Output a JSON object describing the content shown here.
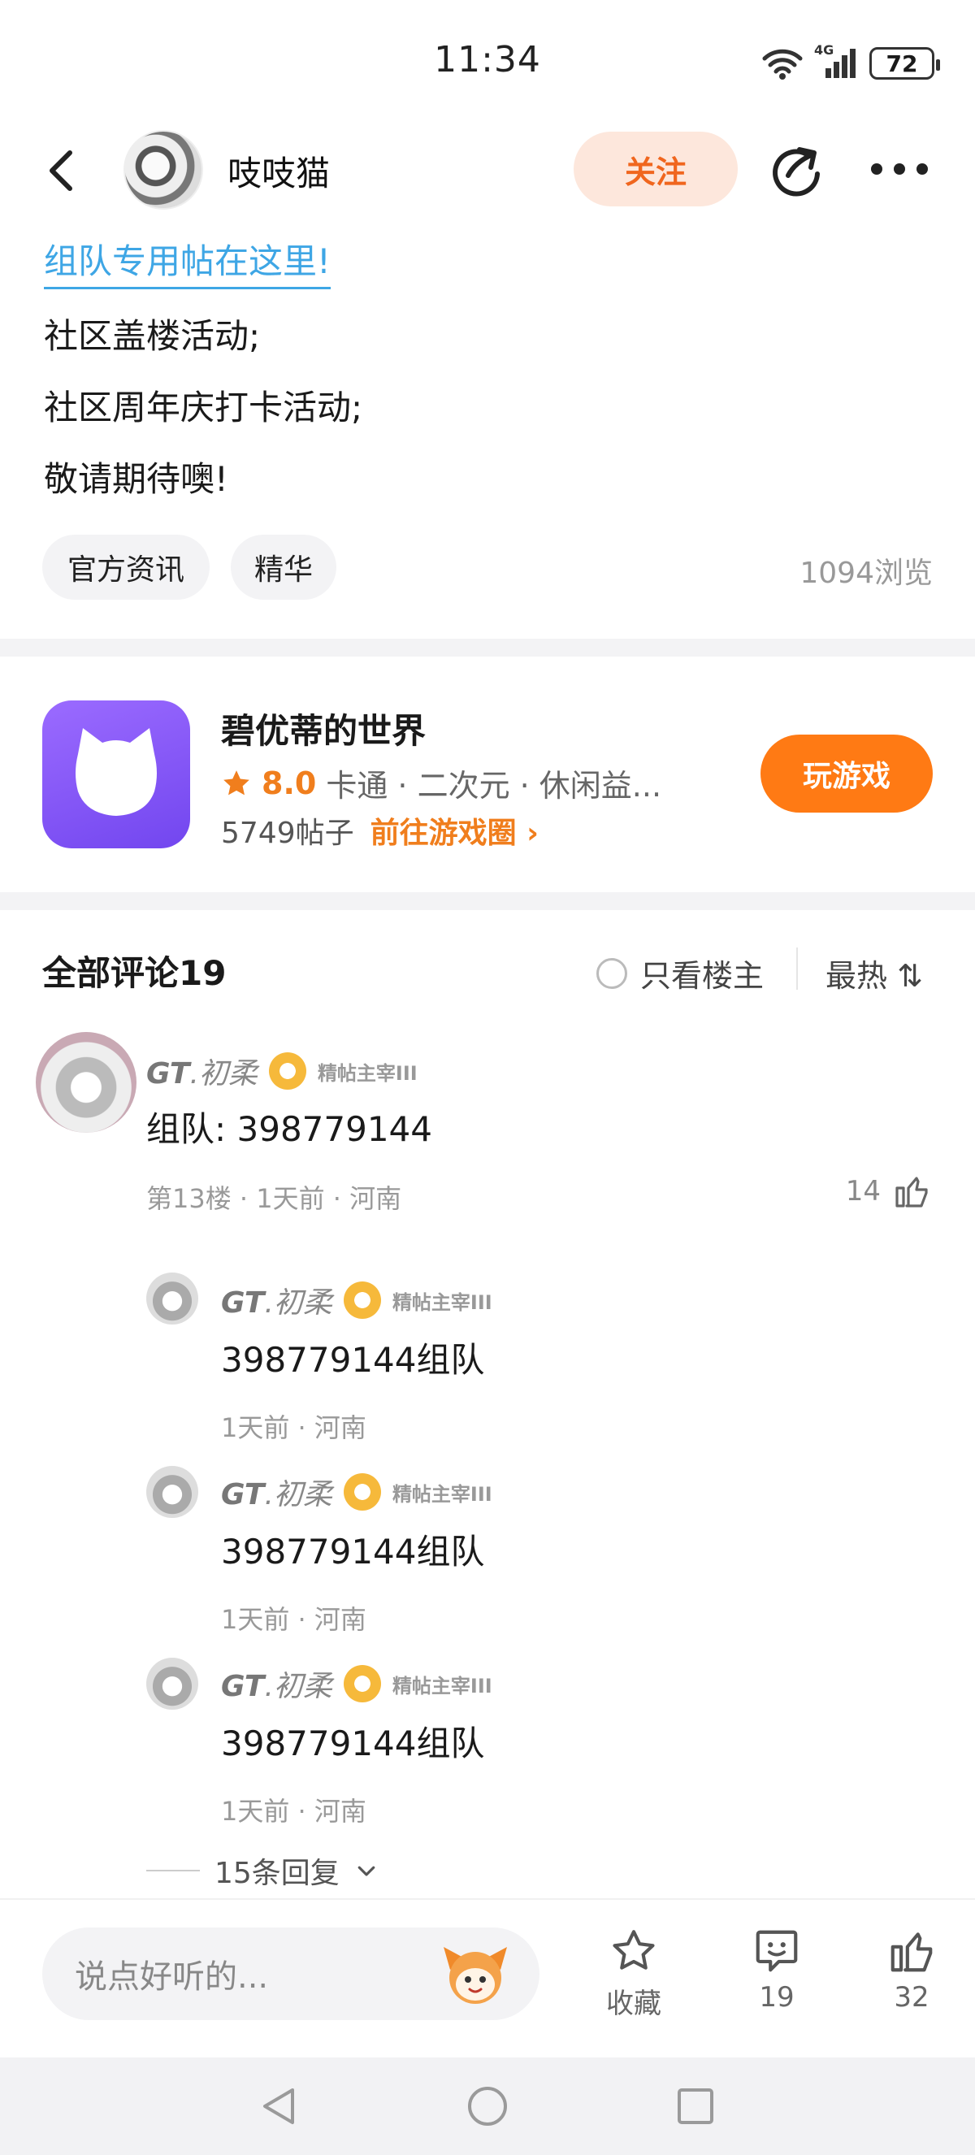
{
  "status_bar": {
    "time": "11:34",
    "battery": "72",
    "network": "4G"
  },
  "header": {
    "author": "吱吱猫",
    "follow_label": "关注"
  },
  "post": {
    "link_text": "组队专用帖在这里!",
    "lines": [
      "社区盖楼活动;",
      "社区周年庆打卡活动;",
      "敬请期待噢!"
    ],
    "tags": [
      "官方资讯",
      "精华"
    ],
    "views": "1094浏览"
  },
  "game": {
    "title": "碧优蒂的世界",
    "rating": "8.0",
    "tags": "卡通 · 二次元 · 休闲益...",
    "posts": "5749帖子",
    "goto_label": "前往游戏圈 ›",
    "play_label": "玩游戏"
  },
  "comments": {
    "header": "全部评论19",
    "only_op": "只看楼主",
    "sort": "最热 ⇅",
    "main": {
      "user_prefix": "GT",
      "user_suffix": ".初柔",
      "badge": "精帖主宰III",
      "text": "组队:  398779144",
      "meta": "第13楼 · 1天前 · 河南",
      "likes": "14"
    },
    "replies": [
      {
        "user_prefix": "GT",
        "user_suffix": ".初柔",
        "badge": "精帖主宰III",
        "text": "398779144组队",
        "meta": "1天前 · 河南"
      },
      {
        "user_prefix": "GT",
        "user_suffix": ".初柔",
        "badge": "精帖主宰III",
        "text": "398779144组队",
        "meta": "1天前 · 河南"
      },
      {
        "user_prefix": "GT",
        "user_suffix": ".初柔",
        "badge": "精帖主宰III",
        "text": "398779144组队",
        "meta": "1天前 · 河南"
      }
    ],
    "more_replies": "15条回复"
  },
  "bottom_bar": {
    "input_placeholder": "说点好听的...",
    "favorite_label": "收藏",
    "comment_count": "19",
    "like_count": "32"
  },
  "colors": {
    "accent": "#ff7a14",
    "link": "#3ea6e5",
    "game_icon": "#7b4ff0"
  }
}
